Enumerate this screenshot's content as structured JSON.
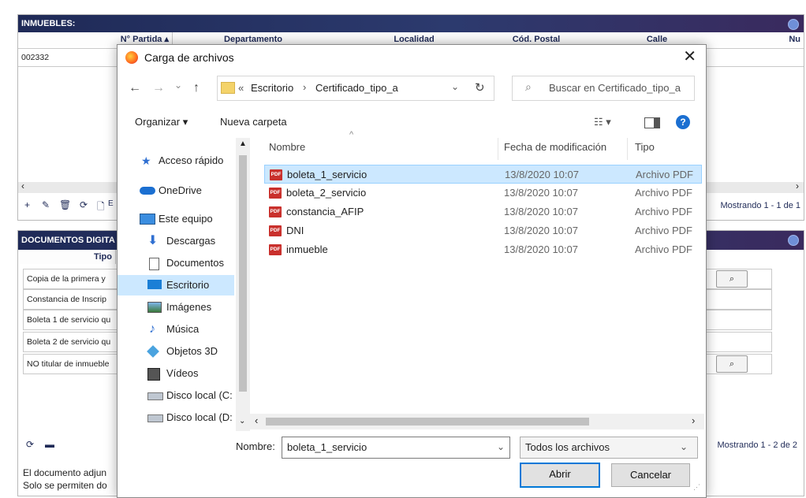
{
  "inmuebles": {
    "title": "INMUEBLES:",
    "columns": [
      "N° Partida ▴",
      "Departamento",
      "Localidad",
      "Cód. Postal",
      "Calle",
      "Nu"
    ],
    "rows": [
      [
        "002332"
      ]
    ],
    "toolbar_icons": [
      "+",
      "✎",
      "🗑",
      "⟳",
      "🗋"
    ],
    "partial_label": "E",
    "pager": "Mostrando 1 - 1 de 1"
  },
  "documentos": {
    "title": "DOCUMENTOS DIGITA",
    "column_tipo": "Tipo",
    "rows": [
      "Copia de la primera y",
      "Constancia de Inscrip",
      "Boleta 1 de servicio qu",
      "Boleta 2 de servicio qu",
      "NO titular de inmueble"
    ],
    "pager": "Mostrando 1 - 2 de 2",
    "footer_note_1": "El documento adjun",
    "footer_note_2": "Solo se permiten do"
  },
  "dialog": {
    "title": "Carga de archivos",
    "close": "✕",
    "nav": {
      "back": "←",
      "forward": "→",
      "recent": "⌄",
      "up": "↑",
      "refresh": "↻"
    },
    "breadcrumb": {
      "prefix": "«",
      "segments": [
        "Escritorio",
        "Certificado_tipo_a"
      ],
      "sep": "›"
    },
    "search_placeholder": "Buscar en Certificado_tipo_a",
    "commands": {
      "organize": "Organizar ▾",
      "new_folder": "Nueva carpeta",
      "view": "☷ ▾",
      "help": "?"
    },
    "sidebar": [
      {
        "label": "Acceso rápido",
        "icon": "star-icon"
      },
      {
        "label": "OneDrive",
        "icon": "cloud-icon"
      },
      {
        "label": "Este equipo",
        "icon": "computer-icon"
      },
      {
        "label": "Descargas",
        "icon": "download-icon"
      },
      {
        "label": "Documentos",
        "icon": "document-icon"
      },
      {
        "label": "Escritorio",
        "icon": "desktop-icon"
      },
      {
        "label": "Imágenes",
        "icon": "image-icon"
      },
      {
        "label": "Música",
        "icon": "music-icon"
      },
      {
        "label": "Objetos 3D",
        "icon": "cube-icon"
      },
      {
        "label": "Vídeos",
        "icon": "video-icon"
      },
      {
        "label": "Disco local (C:",
        "icon": "drive-icon"
      },
      {
        "label": "Disco local (D:",
        "icon": "drive-icon"
      }
    ],
    "columns": {
      "name": "Nombre",
      "modified": "Fecha de modificación",
      "type": "Tipo"
    },
    "files": [
      {
        "name": "boleta_1_servicio",
        "date": "13/8/2020 10:07",
        "type": "Archivo PDF"
      },
      {
        "name": "boleta_2_servicio",
        "date": "13/8/2020 10:07",
        "type": "Archivo PDF"
      },
      {
        "name": "constancia_AFIP",
        "date": "13/8/2020 10:07",
        "type": "Archivo PDF"
      },
      {
        "name": "DNI",
        "date": "13/8/2020 10:07",
        "type": "Archivo PDF"
      },
      {
        "name": "inmueble",
        "date": "13/8/2020 10:07",
        "type": "Archivo PDF"
      }
    ],
    "pdf_badge": "PDF",
    "filename_label": "Nombre:",
    "filename_value": "boleta_1_servicio",
    "filter_value": "Todos los archivos",
    "open_button": "Abrir",
    "cancel_button": "Cancelar",
    "colors": {
      "accent": "#0078d7",
      "selected_row": "#cce8ff",
      "header_bg": "#1f2a57"
    }
  }
}
